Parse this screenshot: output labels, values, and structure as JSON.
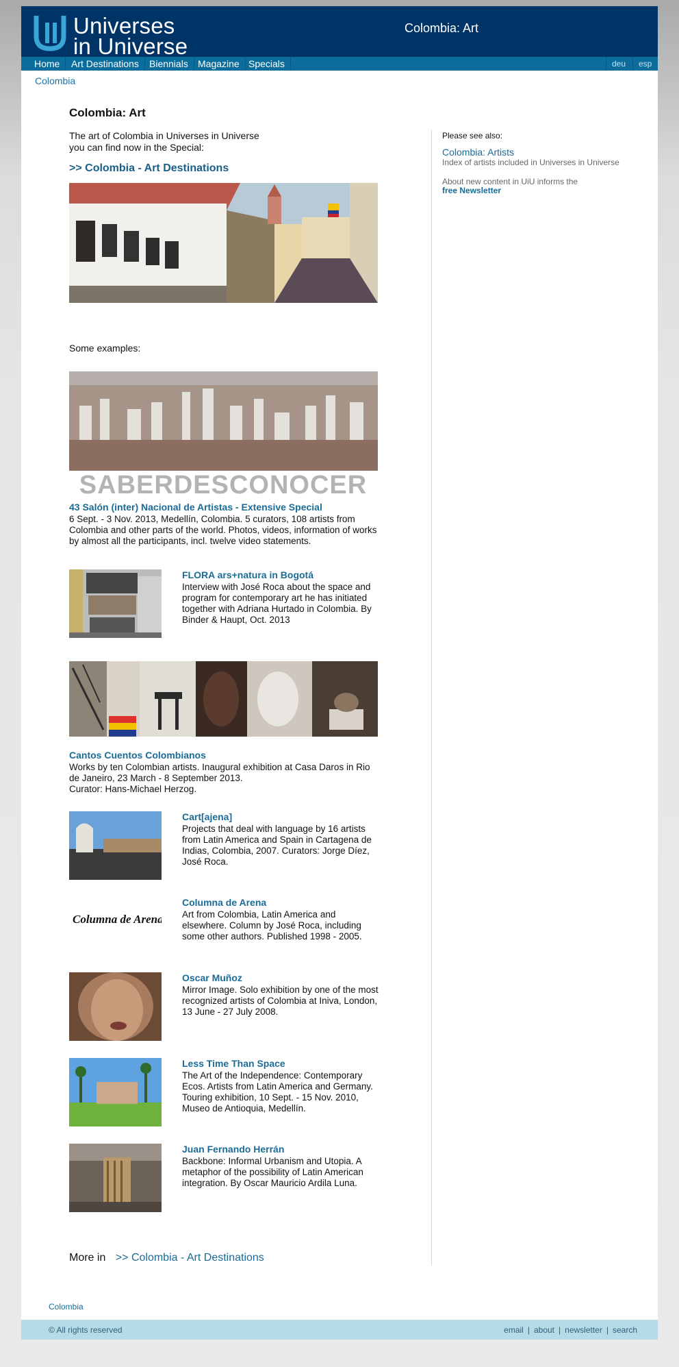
{
  "header": {
    "logo_line1": "Universes",
    "logo_line2": "in Universe",
    "title": "Colombia: Art"
  },
  "nav": {
    "items": [
      "Home",
      "Art Destinations",
      "Biennials",
      "Magazine",
      "Specials"
    ],
    "languages": [
      "deu",
      "esp"
    ]
  },
  "breadcrumb": "Colombia",
  "main": {
    "heading": "Colombia: Art",
    "intro_line1": "The art of Colombia in Universes in Universe",
    "intro_line2": "you can find now in the Special:",
    "dest_link": ">> Colombia - Art Destinations",
    "examples_label": "Some examples:",
    "items": [
      {
        "title": "43 Salón (inter) Nacional de Artistas - Extensive Special",
        "desc": "6 Sept. - 3 Nov. 2013, Medellín, Colombia. 5 curators, 108 artists from Colombia and other parts of the world. Photos, videos, information of works by almost all the participants, incl. twelve video statements."
      },
      {
        "title": "FLORA ars+natura in Bogotá",
        "desc": "Interview with José Roca about the space and program for contemporary art he has initiated together with Adriana Hurtado in Colombia. By Binder & Haupt, Oct. 2013"
      },
      {
        "title": "Cantos Cuentos Colombianos",
        "desc": "Works by ten Colombian artists. Inaugural exhibition at Casa Daros in Rio de Janeiro, 23 March - 8 September 2013.",
        "desc2": "Curator: Hans-Michael Herzog."
      },
      {
        "title": "Cart[ajena]",
        "desc": "Projects that deal with language by 16 artists from Latin America and Spain in Cartagena de Indias, Colombia, 2007. Curators: Jorge Díez, José Roca."
      },
      {
        "title": "Columna de Arena",
        "desc": "Art from Colombia, Latin America and elsewhere. Column by José Roca, including some other authors. Published 1998 - 2005."
      },
      {
        "title": "Oscar Muñoz",
        "desc": "Mirror Image. Solo exhibition by one of the most recognized artists of Colombia at Iniva, London, 13 June - 27 July 2008."
      },
      {
        "title": "Less Time Than Space",
        "desc": "The Art of the Independence: Contemporary Ecos. Artists from Latin America and Germany. Touring exhibition, 10 Sept. - 15 Nov. 2010, Museo de Antioquia, Medellín."
      },
      {
        "title": "Juan Fernando Herrán",
        "desc": "Backbone: Informal Urbanism and Utopia. A metaphor of the possibility of Latin American integration. By Oscar Mauricio Ardila Luna."
      }
    ],
    "banner_text": "SABERDESCONOCER",
    "columna_logo": "Columna de Arena",
    "more_label": "More in",
    "more_link": ">> Colombia - Art Destinations"
  },
  "sidebar": {
    "see_also": "Please see also:",
    "artists_link": "Colombia: Artists",
    "artists_sub": "Index of artists included in Universes in Universe",
    "about_text": "About new content in UiU informs the",
    "newsletter_link": "free Newsletter"
  },
  "footer": {
    "breadcrumb": "Colombia",
    "copyright": "© All rights reserved",
    "links": [
      "email",
      "about",
      "newsletter",
      "search"
    ]
  },
  "colors": {
    "header_bg": "#003366",
    "nav_bg": "#0c6d9c",
    "link": "#1a6b96",
    "footer_bg": "#b5dbe6"
  }
}
